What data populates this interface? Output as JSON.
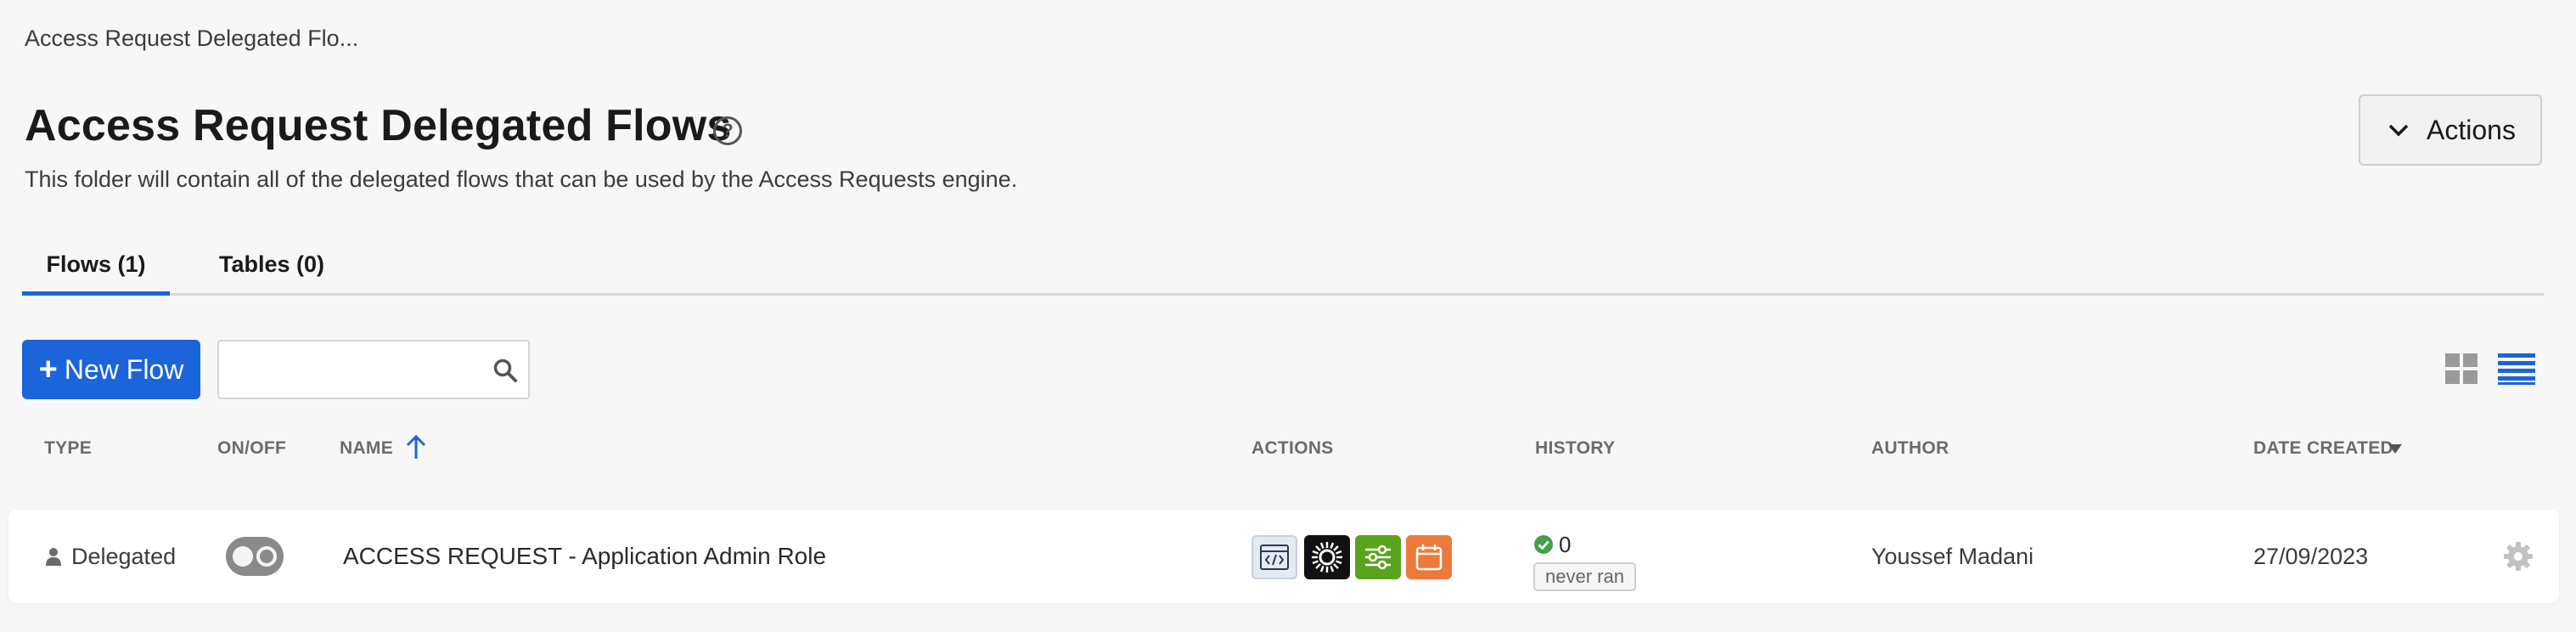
{
  "breadcrumb": "Access Request Delegated Flo...",
  "header": {
    "title": "Access Request Delegated Flows",
    "help": "?",
    "description": "This folder will contain all of the delegated flows that can be used by the Access Requests engine.",
    "actions_label": "Actions"
  },
  "tabs": [
    {
      "label": "Flows (1)",
      "active": true
    },
    {
      "label": "Tables (0)",
      "active": false
    }
  ],
  "toolbar": {
    "new_flow_label": "New Flow",
    "new_flow_icon": "+",
    "search_placeholder": "",
    "search_value": ""
  },
  "columns": [
    "TYPE",
    "ON/OFF",
    "NAME",
    "ACTIONS",
    "HISTORY",
    "AUTHOR",
    "DATE CREATED"
  ],
  "rows": [
    {
      "type": "Delegated",
      "enabled": false,
      "name": "ACCESS REQUEST - Application Admin Role",
      "action_icons": [
        "code-icon",
        "sun-icon",
        "sliders-icon",
        "calendar-icon"
      ],
      "history_count": "0",
      "history_status": "never ran",
      "author": "Youssef Madani",
      "date_created": "27/09/2023"
    }
  ],
  "colors": {
    "primary": "#1b64d9",
    "sliders_bg": "#5aa31f",
    "calendar_bg": "#ec7a3c",
    "success": "#43a047"
  }
}
